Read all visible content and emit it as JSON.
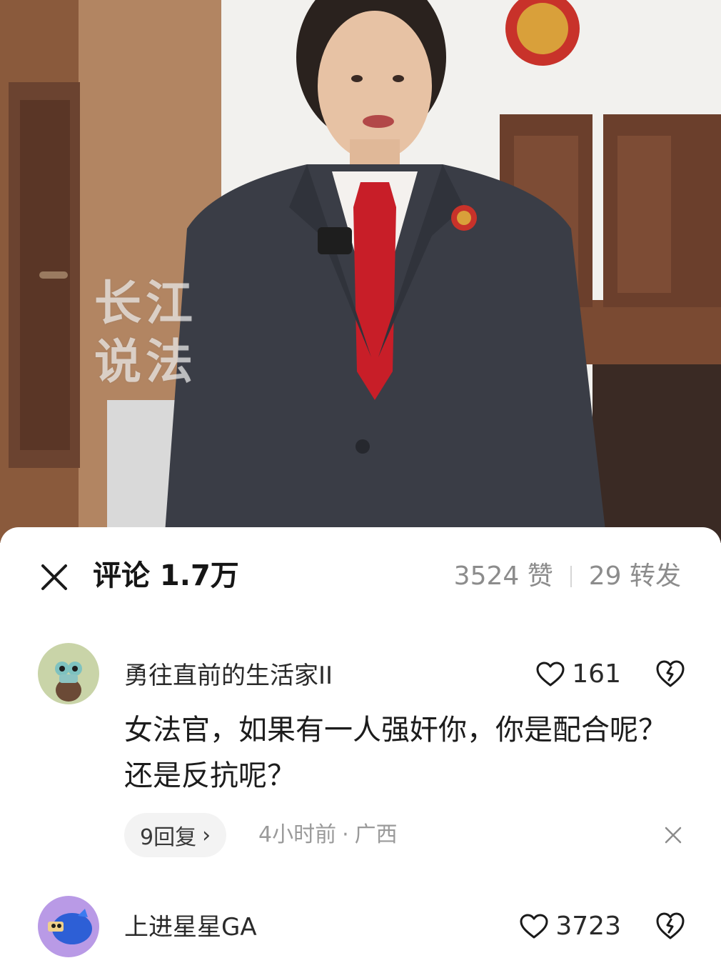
{
  "video": {
    "watermark": "长江说法"
  },
  "header": {
    "close_icon": "close-icon",
    "title": "评论 1.7万",
    "likes": "3524 赞",
    "shares": "29 转发"
  },
  "comments": [
    {
      "username": "勇往直前的生活家II",
      "like_count": "161",
      "text": "女法官，如果有一人强奸你，你是配合呢？还是反抗呢？",
      "reply_label": "9回复",
      "time": "4小时前",
      "location": "广西"
    },
    {
      "username": "上进星星GA",
      "like_count": "3723"
    }
  ],
  "colors": {
    "wall": "#f2f1ee",
    "wood": "#8c5a3c",
    "suit": "#3a3d46",
    "tie": "#c81e28",
    "muted_text": "#8c8c8c"
  }
}
